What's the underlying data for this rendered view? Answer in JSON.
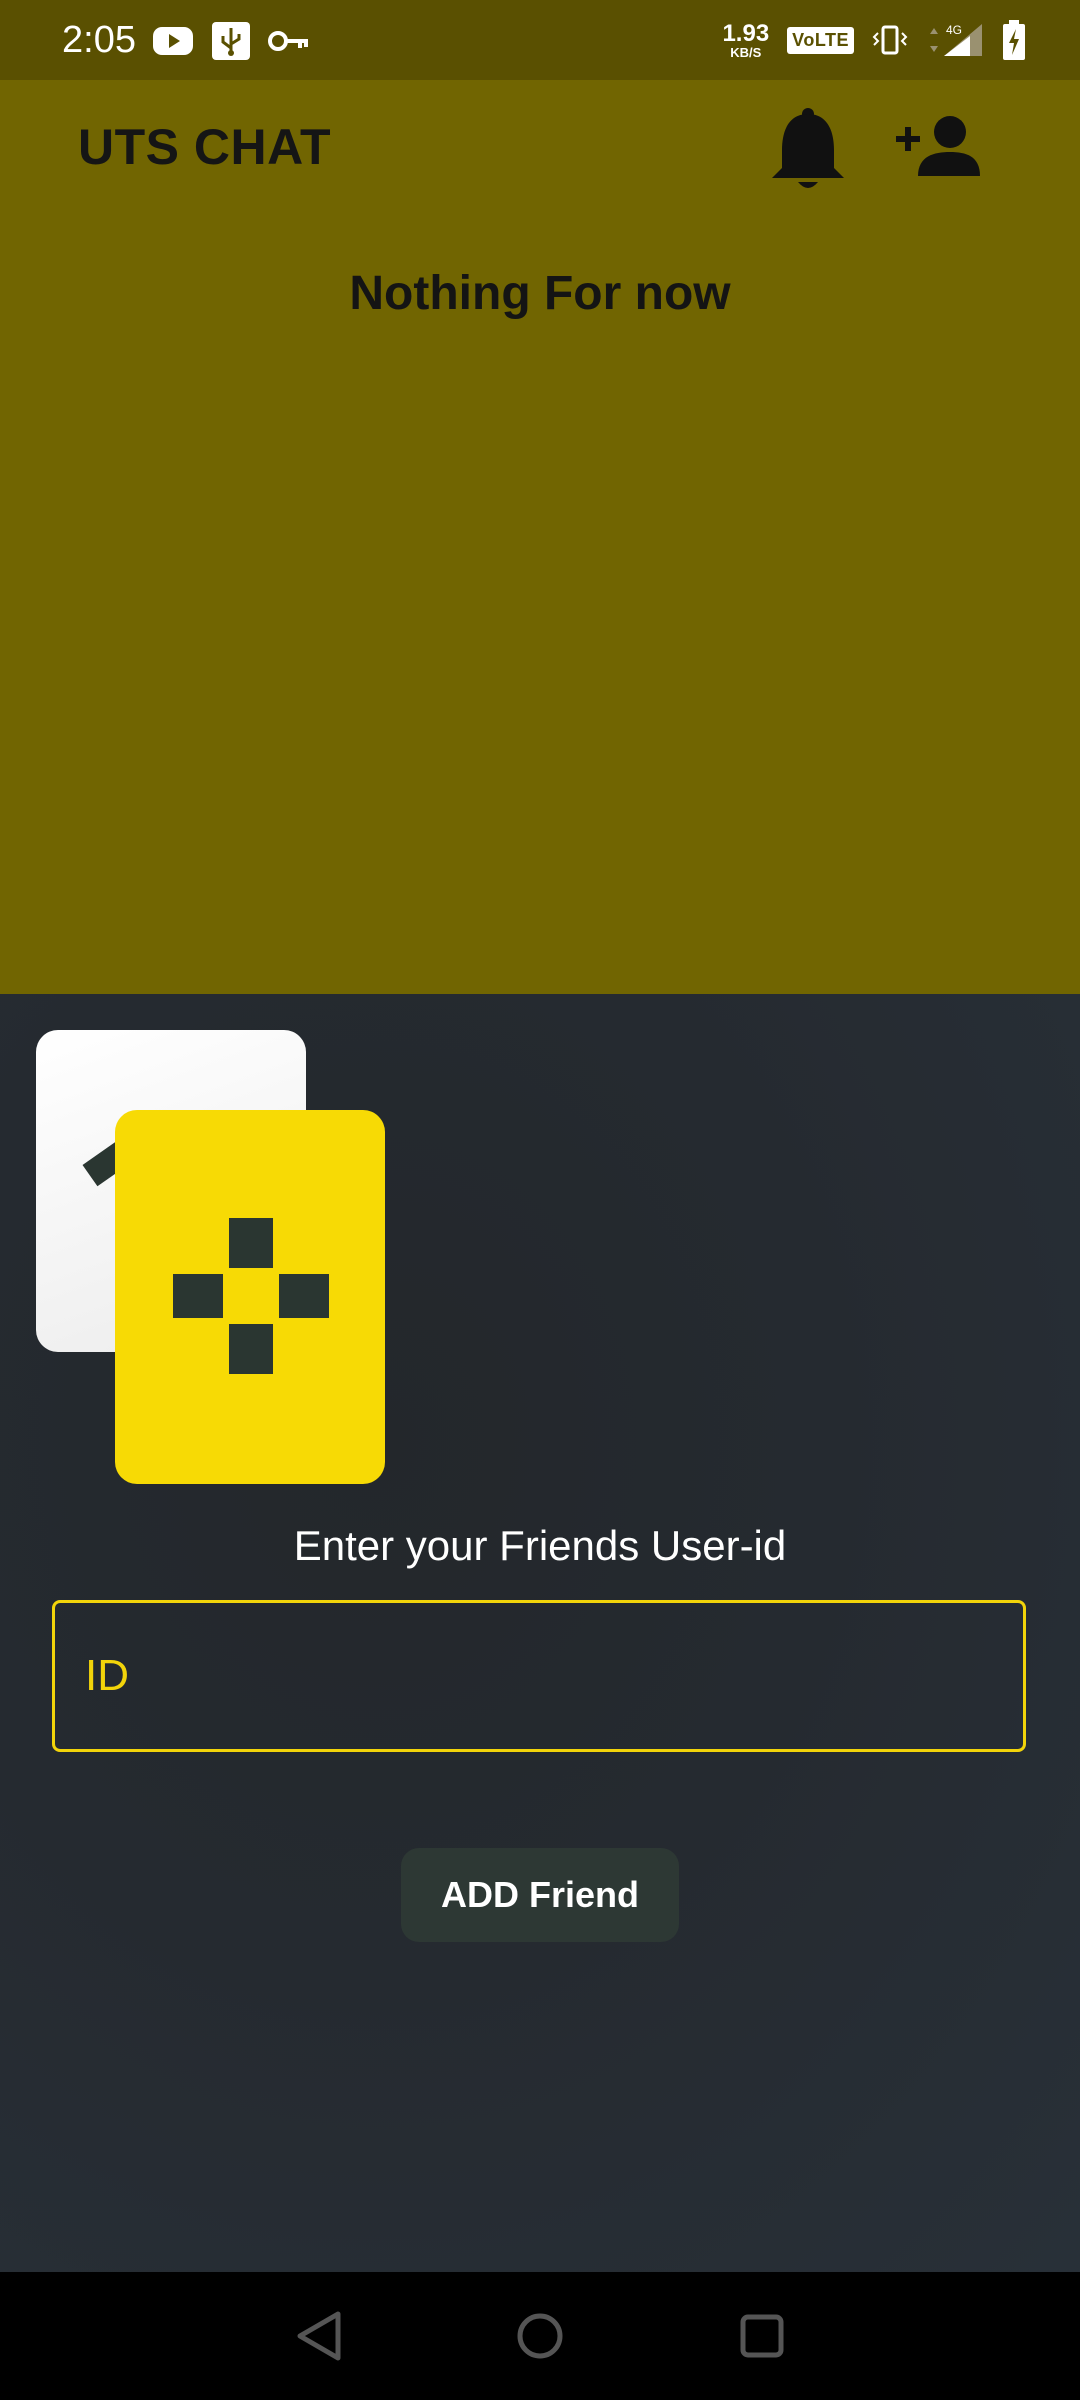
{
  "status_bar": {
    "time": "2:05",
    "net_speed_value": "1.93",
    "net_speed_unit": "KB/S",
    "volte": "VoLTE",
    "network": "4G",
    "icons": [
      "youtube-icon",
      "usb-icon",
      "key-icon",
      "vibrate-icon",
      "signal-icon",
      "battery-charging-icon"
    ]
  },
  "header": {
    "title": "UTS CHAT",
    "notifications_icon": "bell-icon",
    "add_friend_icon": "person-add-icon"
  },
  "main": {
    "empty_message": "Nothing For now"
  },
  "add_friend_sheet": {
    "prompt": "Enter your Friends User-id",
    "input_placeholder": "ID",
    "input_value": "",
    "button_label": "ADD Friend"
  },
  "nav_bar": {
    "icons": [
      "back-icon",
      "home-icon",
      "recents-icon"
    ]
  },
  "colors": {
    "status_bar": "#5a5001",
    "header_bg": "#716501",
    "sheet_bg": "#272c32",
    "accent_yellow": "#f7da05",
    "button_bg": "#2d3834"
  }
}
